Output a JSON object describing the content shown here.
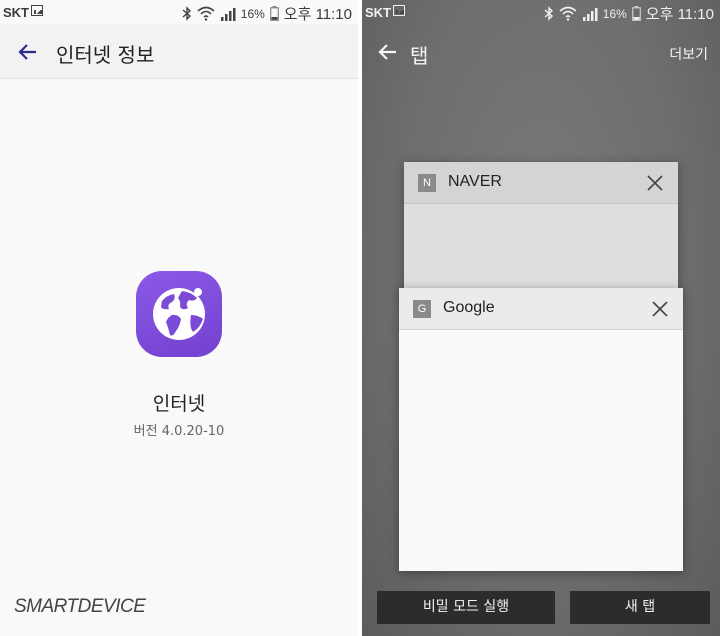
{
  "left_screen": {
    "status_bar": {
      "carrier": "SKT",
      "battery": "16%",
      "time": "오후 11:10"
    },
    "header": {
      "title": "인터넷 정보"
    },
    "app": {
      "name": "인터넷",
      "version": "버전 4.0.20-10"
    },
    "watermark": "SMARTDEVICE"
  },
  "right_screen": {
    "status_bar": {
      "carrier": "SKT",
      "battery": "16%",
      "time": "오후 11:10"
    },
    "header": {
      "title": "탭",
      "more_label": "더보기"
    },
    "tabs": [
      {
        "favicon": "N",
        "title": "NAVER"
      },
      {
        "favicon": "G",
        "title": "Google"
      }
    ],
    "buttons": {
      "secret_mode": "비밀 모드 실행",
      "new_tab": "새 탭"
    }
  },
  "colors": {
    "app_icon": "#7b4bd8",
    "back_arrow_left": "#2b2b8a",
    "tab_overlay": "#707070"
  }
}
